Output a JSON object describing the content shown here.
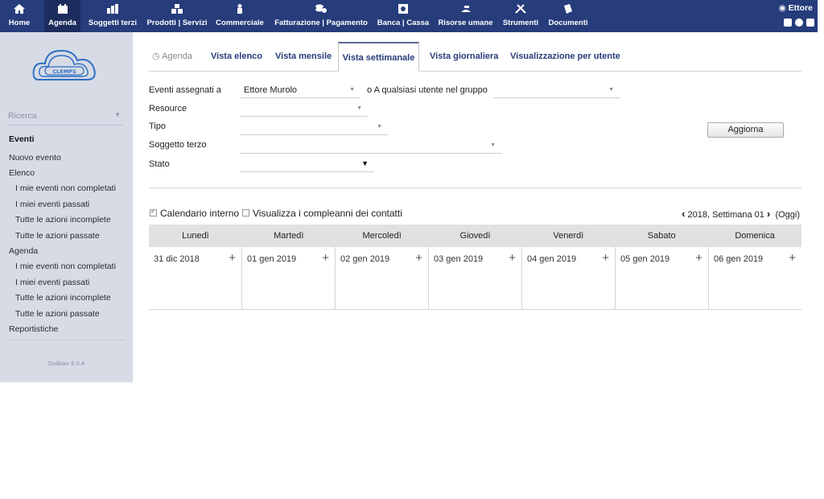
{
  "topmenu": [
    {
      "label": "Home",
      "icon": "home-icon"
    },
    {
      "label": "Agenda",
      "icon": "agenda-icon",
      "active": true
    },
    {
      "label": "Soggetti terzi",
      "icon": "company-icon"
    },
    {
      "label": "Prodotti | Servizi",
      "icon": "products-icon"
    },
    {
      "label": "Commerciale",
      "icon": "commercial-icon"
    },
    {
      "label": "Fatturazione | Pagamento",
      "icon": "billing-icon"
    },
    {
      "label": "Banca | Cassa",
      "icon": "bank-icon"
    },
    {
      "label": "Risorse umane",
      "icon": "hr-icon"
    },
    {
      "label": "Strumenti",
      "icon": "tools-icon"
    },
    {
      "label": "Documenti",
      "icon": "documents-icon"
    }
  ],
  "user": {
    "name": "Ettore"
  },
  "sidebar": {
    "search_placeholder": "Ricerca",
    "items": [
      {
        "label": "Eventi",
        "type": "title"
      },
      {
        "label": "Nuovo evento",
        "type": "main"
      },
      {
        "label": "Elenco",
        "type": "main"
      },
      {
        "label": "I mie eventi non completati",
        "type": "sub"
      },
      {
        "label": "I miei eventi passati",
        "type": "sub"
      },
      {
        "label": "Tutte le azioni incomplete",
        "type": "sub"
      },
      {
        "label": "Tutte le azioni passate",
        "type": "sub"
      },
      {
        "label": "Agenda",
        "type": "main"
      },
      {
        "label": "I mie eventi non completati",
        "type": "sub"
      },
      {
        "label": "I miei eventi passati",
        "type": "sub"
      },
      {
        "label": "Tutte le azioni incomplete",
        "type": "sub"
      },
      {
        "label": "Tutte le azioni passate",
        "type": "sub"
      },
      {
        "label": "Reportistiche",
        "type": "main"
      }
    ],
    "version": "Dolibarr 8.0.4",
    "logo_text": "CLEMPS"
  },
  "tabs": {
    "home": "Agenda",
    "list": "Vista elenco",
    "month": "Vista mensile",
    "week": "Vista settimanale",
    "day": "Vista giornaliera",
    "per_user": "Visualizzazione per utente"
  },
  "filters": {
    "assigned_label": "Eventi assegnati a",
    "assigned_value": "Ettore Murolo",
    "or_group_label": "o A qualsiasi utente nel gruppo",
    "resource_label": "Resource",
    "type_label": "Tipo",
    "third_party_label": "Soggetto terzo",
    "status_label": "Stato",
    "refresh_button": "Aggiorna"
  },
  "options": {
    "internal_calendar": "Calendario interno",
    "internal_calendar_checked": true,
    "birthdays": "Visualizza i compleanni dei contatti",
    "birthdays_checked": false
  },
  "week_nav": {
    "prev": "‹",
    "label": "2018, Settimana 01",
    "next": "›",
    "today": "(Oggi)"
  },
  "calendar": {
    "days": [
      "Lunedì",
      "Martedì",
      "Mercoledì",
      "Giovedì",
      "Venerdì",
      "Sabato",
      "Domenica"
    ],
    "dates": [
      "31 dic 2018",
      "01 gen 2019",
      "02 gen 2019",
      "03 gen 2019",
      "04 gen 2019",
      "05 gen 2019",
      "06 gen 2019"
    ],
    "add_symbol": "+"
  },
  "colors": {
    "topbar": "#263c7b",
    "sidebar": "#d7dbe6",
    "calendar_header": "#e1e1e1"
  }
}
